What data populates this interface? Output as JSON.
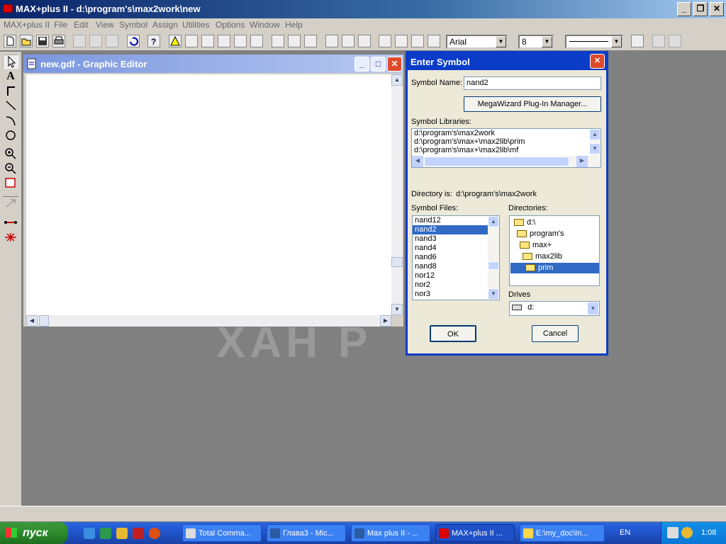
{
  "window": {
    "title": "MAX+plus II - d:\\program's\\max2work\\new"
  },
  "menu": [
    "MAX+plus II",
    "File",
    "Edit",
    "View",
    "Symbol",
    "Assign",
    "Utilities",
    "Options",
    "Window",
    "Help"
  ],
  "toolbar": {
    "font": "Arial",
    "size": "8"
  },
  "editor": {
    "title": "new.gdf - Graphic Editor"
  },
  "watermark": "ХАН Р",
  "dialog": {
    "title": "Enter Symbol",
    "symbol_name_label": "Symbol Name:",
    "symbol_name_value": "nand2",
    "megawizard_label": "MegaWizard Plug-In Manager...",
    "libraries_label": "Symbol Libraries:",
    "libraries": [
      "d:\\program's\\max2work",
      "d:\\program's\\max+\\max2lib\\prim",
      "d:\\program's\\max+\\max2lib\\mf"
    ],
    "directory_label": "Directory is:",
    "directory_value": "d:\\program's\\max2work",
    "files_label": "Symbol Files:",
    "files": [
      "nand12",
      "nand2",
      "nand3",
      "nand4",
      "nand6",
      "nand8",
      "nor12",
      "nor2",
      "nor3"
    ],
    "selected_file": "nand2",
    "directories_label": "Directories:",
    "directories": [
      "d:\\",
      "program's",
      "max+",
      "max2lib",
      "prim"
    ],
    "selected_directory": "prim",
    "drives_label": "Drives",
    "drive_value": "d:",
    "ok_label": "OK",
    "cancel_label": "Cancel"
  },
  "taskbar": {
    "start_label": "пуск",
    "tasks": [
      "Total Comma...",
      "Глава3 - Mic...",
      "Max plus II - ...",
      "MAX+plus II ...",
      "E:\\my_doc\\In..."
    ],
    "active_task": "MAX+plus II ...",
    "language": "EN",
    "clock": "1:08"
  }
}
